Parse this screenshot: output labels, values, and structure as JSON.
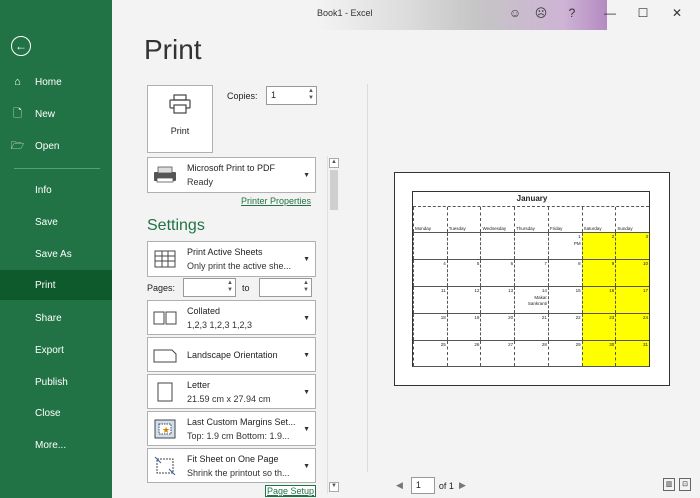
{
  "window": {
    "title": "Book1  -  Excel",
    "smile": "☺",
    "frown": "☹",
    "help": "?",
    "min": "—",
    "max": "☐",
    "close": "✕"
  },
  "sidebar": {
    "back": "←",
    "items": [
      {
        "label": "Home",
        "icon": "⌂"
      },
      {
        "label": "New",
        "icon": "🗋"
      },
      {
        "label": "Open",
        "icon": "🗁"
      },
      {
        "label": "Info"
      },
      {
        "label": "Save"
      },
      {
        "label": "Save As"
      },
      {
        "label": "Print"
      },
      {
        "label": "Share"
      },
      {
        "label": "Export"
      },
      {
        "label": "Publish"
      },
      {
        "label": "Close"
      },
      {
        "label": "More..."
      }
    ],
    "active": "Print"
  },
  "print": {
    "heading": "Print",
    "button": "Print",
    "copies_label": "Copies:",
    "copies_value": "1",
    "printer_name": "Microsoft Print to PDF",
    "printer_status": "Ready",
    "printer_properties": "Printer Properties",
    "settings_heading": "Settings",
    "scope_l1": "Print Active Sheets",
    "scope_l2": "Only print the active she...",
    "pages_label": "Pages:",
    "pages_to": "to",
    "collate_l1": "Collated",
    "collate_l2": "1,2,3    1,2,3    1,2,3",
    "orientation": "Landscape Orientation",
    "paper_l1": "Letter",
    "paper_l2": "21.59 cm x 27.94 cm",
    "margins_l1": "Last Custom Margins Set...",
    "margins_l2": "Top: 1.9 cm Bottom: 1.9...",
    "scaling_l1": "Fit Sheet on One Page",
    "scaling_l2": "Shrink the printout so th...",
    "page_setup": "Page Setup"
  },
  "preview": {
    "cal_title": "January",
    "days": [
      "Monday",
      "Tuesday",
      "Wednesday",
      "Thursday",
      "Friday",
      "Saturday",
      "Sunday"
    ],
    "rows": [
      [
        "",
        "",
        "",
        "",
        "1",
        "2",
        "3"
      ],
      [
        "4",
        "5",
        "6",
        "7",
        "8",
        "9",
        "10"
      ],
      [
        "11",
        "12",
        "13",
        "14",
        "15",
        "16",
        "17"
      ],
      [
        "18",
        "19",
        "20",
        "21",
        "22",
        "23",
        "24"
      ],
      [
        "25",
        "26",
        "27",
        "28",
        "29",
        "30",
        "31"
      ]
    ],
    "event_pm": "PM",
    "event_makar": "Makar",
    "event_sankranti": "Sankranti",
    "page_current": "1",
    "page_of": "of 1",
    "highlight_color": "#ffff00"
  }
}
